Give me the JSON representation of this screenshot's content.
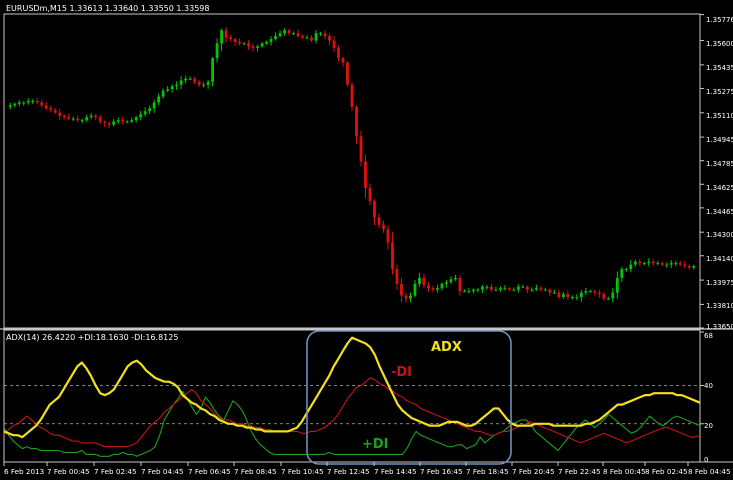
{
  "window": {
    "main_header": "EURUSDm,M15  1.33613 1.33640 1.33550 1.33598",
    "indicator_header": "ADX(14) 26.4220 +DI:18.1630 -DI:16.8125"
  },
  "annotations": {
    "adx": "ADX",
    "minus_di": "-DI",
    "plus_di": "+DI"
  },
  "colors": {
    "background": "#000000",
    "up_candle": "#00c800",
    "down_candle": "#e01010",
    "adx": "#f0e020",
    "plus_di": "#1ea01e",
    "minus_di": "#c81414",
    "highlight_box": "#6f8fc0",
    "text": "#ffffff"
  },
  "chart_data": [
    {
      "type": "candlestick",
      "title": "EURUSDm,M15",
      "ohlc_last": {
        "open": 1.33613,
        "high": 1.3364,
        "low": 1.3355,
        "close": 1.33598
      },
      "y_ticks": [
        "1.35776",
        "1.35600",
        "1.35435",
        "1.35275",
        "1.35110",
        "1.34945",
        "1.34785",
        "1.34625",
        "1.34465",
        "1.34300",
        "1.34140",
        "1.33975",
        "1.33810",
        "1.33650"
      ],
      "ylim": [
        1.3365,
        1.3578
      ],
      "close": [
        1.3516,
        1.3517,
        1.3518,
        1.3518,
        1.3519,
        1.3519,
        1.3518,
        1.3516,
        1.3514,
        1.3513,
        1.3511,
        1.3509,
        1.3508,
        1.3507,
        1.3507,
        1.3506,
        1.3506,
        1.3508,
        1.3509,
        1.3508,
        1.3505,
        1.3504,
        1.3503,
        1.3505,
        1.3506,
        1.3505,
        1.3505,
        1.3506,
        1.3508,
        1.351,
        1.3512,
        1.3514,
        1.3518,
        1.3522,
        1.3526,
        1.3527,
        1.3529,
        1.353,
        1.3533,
        1.3534,
        1.3534,
        1.3532,
        1.353,
        1.353,
        1.3532,
        1.3548,
        1.3558,
        1.3567,
        1.3562,
        1.3561,
        1.3559,
        1.3558,
        1.3558,
        1.3556,
        1.3555,
        1.3556,
        1.3558,
        1.3559,
        1.3561,
        1.3563,
        1.3565,
        1.3567,
        1.3565,
        1.3565,
        1.3563,
        1.3562,
        1.3562,
        1.356,
        1.3565,
        1.3565,
        1.3563,
        1.356,
        1.3555,
        1.3548,
        1.3545,
        1.353,
        1.3515,
        1.3495,
        1.3478,
        1.346,
        1.3451,
        1.344,
        1.3435,
        1.3432,
        1.3423,
        1.3405,
        1.3395,
        1.3387,
        1.3385,
        1.3387,
        1.3395,
        1.3399,
        1.3394,
        1.3392,
        1.3391,
        1.3392,
        1.3395,
        1.3396,
        1.3398,
        1.3399,
        1.339,
        1.339,
        1.339,
        1.3391,
        1.3391,
        1.3393,
        1.3393,
        1.3391,
        1.3391,
        1.3392,
        1.3392,
        1.3391,
        1.3391,
        1.3393,
        1.3393,
        1.3391,
        1.3391,
        1.3392,
        1.3391,
        1.3391,
        1.3389,
        1.3389,
        1.3386,
        1.3388,
        1.3386,
        1.3386,
        1.3386,
        1.3389,
        1.339,
        1.339,
        1.3389,
        1.3388,
        1.3385,
        1.3385,
        1.3389,
        1.3399,
        1.3405,
        1.3405,
        1.3408,
        1.341,
        1.3409,
        1.3409,
        1.341,
        1.3409,
        1.3409,
        1.3408,
        1.3408,
        1.3409,
        1.3409,
        1.3408,
        1.3407,
        1.3406,
        1.3407
      ],
      "x_ticks": [
        "6 Feb 2013",
        "7 Feb 00:45",
        "7 Feb 02:45",
        "7 Feb 04:45",
        "7 Feb 06:45",
        "7 Feb 08:45",
        "7 Feb 10:45",
        "7 Feb 12:45",
        "7 Feb 14:45",
        "7 Feb 16:45",
        "7 Feb 18:45",
        "7 Feb 20:45",
        "7 Feb 22:45",
        "8 Feb 00:45",
        "8 Feb 02:45",
        "8 Feb 04:45"
      ]
    },
    {
      "type": "line",
      "title": "ADX(14) 26.4220 +DI:18.1630 -DI:16.8125",
      "ylim": [
        0,
        68
      ],
      "y_ticks": [
        68,
        40,
        20,
        0
      ],
      "levels": [
        40,
        20
      ],
      "series": [
        {
          "name": "ADX",
          "values": [
            16,
            15,
            14,
            14,
            13,
            15,
            17,
            19,
            22,
            26,
            30,
            32,
            34,
            38,
            42,
            46,
            50,
            52,
            49,
            45,
            40,
            36,
            35,
            36,
            38,
            42,
            46,
            50,
            52,
            53,
            51,
            48,
            46,
            44,
            43,
            42,
            42,
            41,
            39,
            35,
            33,
            31,
            30,
            28,
            27,
            25,
            24,
            22,
            21,
            20,
            20,
            19,
            19,
            18,
            18,
            17,
            17,
            16,
            16,
            16,
            16,
            16,
            16,
            17,
            18,
            21,
            25,
            29,
            33,
            37,
            41,
            45,
            50,
            54,
            58,
            62,
            65,
            64,
            63,
            62,
            60,
            56,
            50,
            45,
            40,
            35,
            30,
            27,
            25,
            23,
            22,
            21,
            20,
            19,
            19,
            19,
            20,
            21,
            21,
            21,
            20,
            19,
            19,
            20,
            22,
            24,
            26,
            28,
            28,
            25,
            22,
            20,
            19,
            19,
            19,
            19,
            20,
            20,
            20,
            20,
            19,
            19,
            19,
            19,
            19,
            19,
            19,
            20,
            20,
            21,
            22,
            24,
            26,
            28,
            30,
            30,
            31,
            32,
            33,
            34,
            35,
            35,
            36,
            36,
            36,
            36,
            36,
            35,
            35,
            34,
            33,
            32,
            31
          ]
        },
        {
          "name": "+DI",
          "values": [
            18,
            14,
            11,
            9,
            7,
            8,
            7,
            7,
            6,
            6,
            6,
            6,
            6,
            5,
            5,
            5,
            5,
            6,
            4,
            4,
            4,
            3,
            3,
            3,
            4,
            4,
            5,
            4,
            4,
            3,
            4,
            5,
            6,
            8,
            14,
            22,
            26,
            30,
            33,
            37,
            33,
            29,
            25,
            28,
            34,
            31,
            27,
            24,
            22,
            27,
            32,
            30,
            27,
            22,
            16,
            12,
            9,
            7,
            5,
            4,
            4,
            4,
            4,
            4,
            4,
            4,
            4,
            4,
            4,
            4,
            4,
            5,
            4,
            4,
            4,
            4,
            4,
            4,
            4,
            4,
            4,
            4,
            4,
            4,
            4,
            4,
            4,
            4,
            7,
            12,
            16,
            14,
            13,
            12,
            11,
            10,
            9,
            8,
            8,
            9,
            9,
            7,
            8,
            9,
            13,
            10,
            12,
            14,
            15,
            16,
            18,
            20,
            21,
            22,
            22,
            20,
            16,
            14,
            12,
            10,
            8,
            6,
            9,
            12,
            15,
            18,
            20,
            22,
            20,
            18,
            20,
            22,
            25,
            23,
            21,
            19,
            17,
            15,
            16,
            18,
            21,
            24,
            22,
            20,
            19,
            21,
            23,
            24,
            23,
            22,
            21,
            20,
            19
          ]
        },
        {
          "name": "-DI",
          "values": [
            14,
            17,
            19,
            20,
            22,
            24,
            22,
            20,
            18,
            17,
            15,
            14,
            14,
            13,
            12,
            11,
            11,
            10,
            10,
            10,
            10,
            9,
            8,
            8,
            8,
            8,
            8,
            8,
            9,
            10,
            13,
            16,
            19,
            21,
            23,
            26,
            28,
            30,
            32,
            34,
            36,
            38,
            36,
            32,
            30,
            28,
            25,
            23,
            22,
            22,
            21,
            20,
            20,
            19,
            19,
            18,
            18,
            17,
            17,
            16,
            16,
            16,
            16,
            16,
            16,
            15,
            15,
            16,
            16,
            17,
            18,
            20,
            22,
            25,
            29,
            33,
            36,
            39,
            40,
            42,
            44,
            43,
            41,
            40,
            38,
            37,
            35,
            34,
            32,
            31,
            30,
            28,
            27,
            26,
            25,
            24,
            23,
            22,
            21,
            20,
            19,
            18,
            17,
            16,
            16,
            15,
            14,
            14,
            15,
            16,
            16,
            17,
            18,
            19,
            20,
            21,
            20,
            19,
            18,
            17,
            16,
            15,
            14,
            13,
            12,
            11,
            10,
            11,
            12,
            13,
            14,
            15,
            14,
            13,
            12,
            11,
            10,
            11,
            12,
            13,
            14,
            15,
            16,
            17,
            18,
            18,
            17,
            16,
            15,
            14,
            13,
            13,
            14
          ]
        }
      ]
    }
  ]
}
